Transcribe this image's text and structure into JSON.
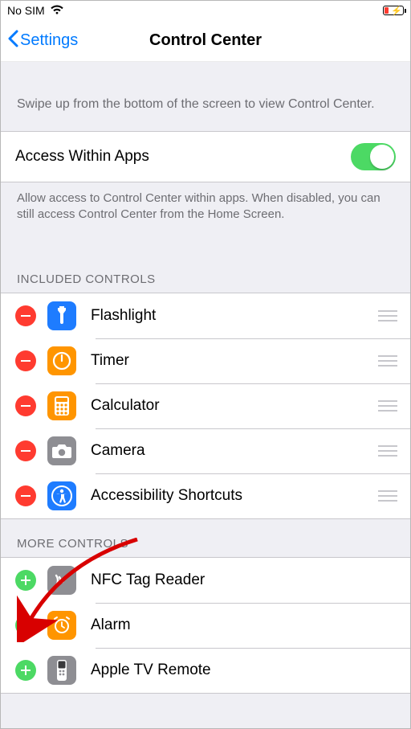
{
  "status": {
    "carrier": "No SIM"
  },
  "nav": {
    "back_label": "Settings",
    "title": "Control Center"
  },
  "hint_top": "Swipe up from the bottom of the screen to view Control Center.",
  "access_within_apps": {
    "label": "Access Within Apps",
    "enabled": true
  },
  "footnote": "Allow access to Control Center within apps. When disabled, you can still access Control Center from the Home Screen.",
  "sections": {
    "included_header": "INCLUDED CONTROLS",
    "more_header": "MORE CONTROLS"
  },
  "included": [
    {
      "label": "Flashlight",
      "icon": "flashlight",
      "icon_color": "blue"
    },
    {
      "label": "Timer",
      "icon": "timer",
      "icon_color": "orange"
    },
    {
      "label": "Calculator",
      "icon": "calculator",
      "icon_color": "orange"
    },
    {
      "label": "Camera",
      "icon": "camera",
      "icon_color": "grey"
    },
    {
      "label": "Accessibility Shortcuts",
      "icon": "accessibility",
      "icon_color": "blue"
    }
  ],
  "more": [
    {
      "label": "NFC Tag Reader",
      "icon": "nfc",
      "icon_color": "grey"
    },
    {
      "label": "Alarm",
      "icon": "alarm",
      "icon_color": "orange"
    },
    {
      "label": "Apple TV Remote",
      "icon": "remote",
      "icon_color": "grey"
    }
  ]
}
